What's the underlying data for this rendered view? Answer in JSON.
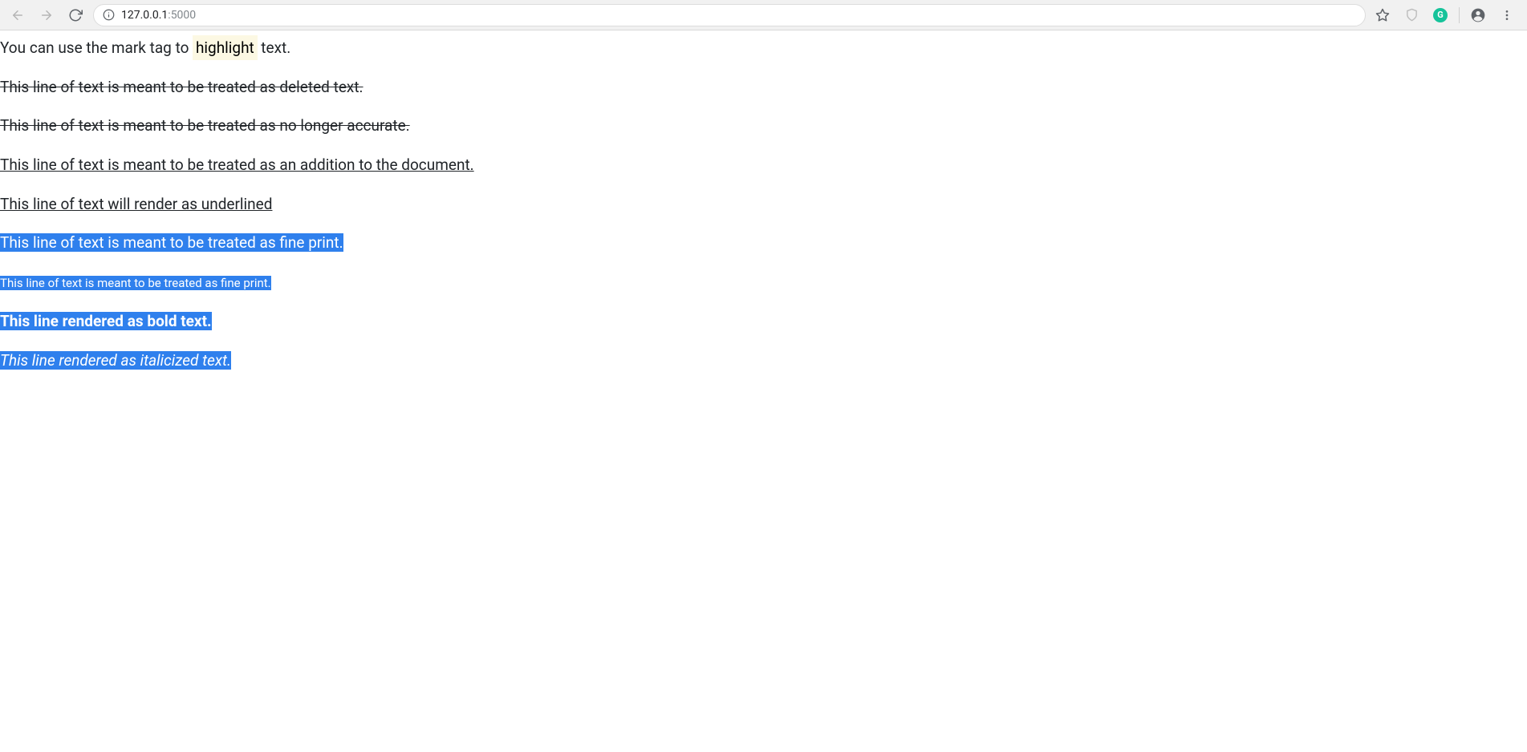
{
  "browser": {
    "url_host": "127.0.0.1",
    "url_port": ":5000",
    "grammarly_letter": "G"
  },
  "content": {
    "p1_prefix": "You can use the mark tag to ",
    "p1_mark": "highlight",
    "p1_suffix": " text.",
    "p2": "This line of text is meant to be treated as deleted text.",
    "p3": "This line of text is meant to be treated as no longer accurate.",
    "p4": "This line of text is meant to be treated as an addition to the document.",
    "p5": "This line of text will render as underlined",
    "p6": "This line of text is meant to be treated as fine print.",
    "p7": "This line of text is meant to be treated as fine print.",
    "p8": "This line rendered as bold text.",
    "p9": "This line rendered as italicized text."
  }
}
